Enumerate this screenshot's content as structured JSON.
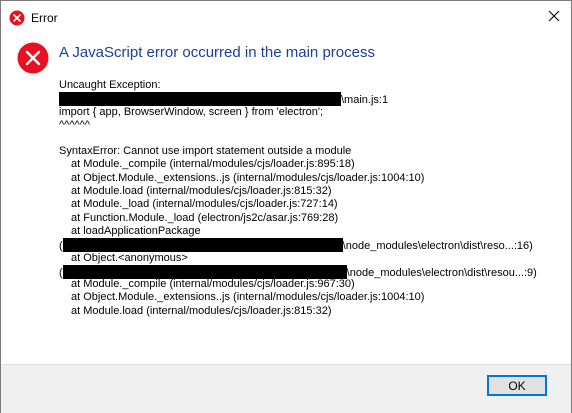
{
  "window": {
    "title": "Error",
    "close_glyph": "✕"
  },
  "dialog": {
    "heading": "A JavaScript error occurred in the main process",
    "lines": [
      {
        "text": "Uncaught Exception:",
        "indent": false
      },
      {
        "prefix": "",
        "suffix": "\\main.js:1",
        "redacted": true,
        "indent": false
      },
      {
        "text": "import { app, BrowserWindow, screen } from 'electron';",
        "indent": false
      },
      {
        "text": "^^^^^^",
        "indent": false
      },
      {
        "text": "",
        "indent": false,
        "gap": true
      },
      {
        "text": "SyntaxError: Cannot use import statement outside a module",
        "indent": false
      },
      {
        "text": "at Module._compile (internal/modules/cjs/loader.js:895:18)",
        "indent": true
      },
      {
        "text": "at Object.Module._extensions..js (internal/modules/cjs/loader.js:1004:10)",
        "indent": true
      },
      {
        "text": "at Module.load (internal/modules/cjs/loader.js:815:32)",
        "indent": true
      },
      {
        "text": "at Module._load (internal/modules/cjs/loader.js:727:14)",
        "indent": true
      },
      {
        "text": "at Function.Module._load (electron/js2c/asar.js:769:28)",
        "indent": true
      },
      {
        "text": "at loadApplicationPackage",
        "indent": true
      },
      {
        "prefix": "(",
        "suffix": "\\node_modules\\electron\\dist\\reso...:16)",
        "redacted": true,
        "indent": false
      },
      {
        "text": "at Object.<anonymous>",
        "indent": true
      },
      {
        "prefix": "(",
        "suffix": "\\node_modules\\electron\\dist\\resou...:9)",
        "redacted": true,
        "indent": false
      },
      {
        "text": "at Module._compile (internal/modules/cjs/loader.js:967:30)",
        "indent": true
      },
      {
        "text": "at Object.Module._extensions..js (internal/modules/cjs/loader.js:1004:10)",
        "indent": true
      },
      {
        "text": "at Module.load (internal/modules/cjs/loader.js:815:32)",
        "indent": true
      }
    ]
  },
  "footer": {
    "ok_label": "OK"
  },
  "colors": {
    "heading": "#1c3f96",
    "error_icon": "#e81123",
    "button_border": "#0078d7",
    "footer_bg": "#f0f0f0"
  },
  "icons": {
    "title_icon": "error-icon",
    "main_icon": "error-icon",
    "close_icon": "close-icon"
  }
}
